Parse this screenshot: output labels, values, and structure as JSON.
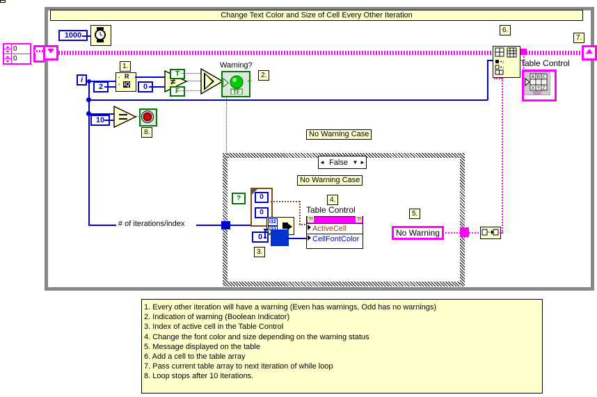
{
  "diagram": {
    "title": "Change Text Color and Size of Cell Every Other Iteration",
    "iteration_terminal": "i",
    "wait_constant": "1000",
    "wait_icon": "clock-icon",
    "divisor_constant": "2",
    "remainder_compare_constant": "0",
    "stop_compare_constant": "10",
    "quotient_remainder_labels": {
      "top": "R",
      "bottom": "IQ"
    },
    "not_equal_symbol": "≠",
    "equal_symbol": "=",
    "select_true_constant": "T",
    "select_false_constant": "F",
    "warning_indicator_label": "Warning?",
    "warning_indicator_tf": "TF",
    "iterations_wire_label": "# of iterations/index",
    "case_outer_label": "No Warning Case",
    "case_inner_label": "No Warning Case",
    "case_selector_value": "False",
    "case_selector_left_arrow": "◄",
    "case_selector_right_arrow": "►",
    "case_selector_chevron": "▼",
    "case_selector_terminal": "?",
    "property_node_label": "Table Control",
    "property_node_rows": [
      {
        "name": "ActiveCell",
        "color": "#8B4513"
      },
      {
        "name": "CellFontColor",
        "color": "#0000CC"
      }
    ],
    "cluster_constant_values": [
      "0",
      "0"
    ],
    "bundle_input_types": [
      "I32",
      "I32"
    ],
    "index_constant": "0",
    "no_warning_string": "No Warning",
    "table_indicator_label": "Table Control",
    "table_icon_rows": [
      [
        "A",
        "B",
        "C"
      ],
      [
        ":",
        ":",
        ":"
      ],
      [
        "X",
        "Y",
        "Z"
      ]
    ],
    "table_icon_type": "abc",
    "array_control_values": [
      "0",
      "0"
    ],
    "callouts": {
      "c1": "1.",
      "c2": "2.",
      "c3": "3.",
      "c4": "4.",
      "c5": "5.",
      "c6": "6.",
      "c7": "7.",
      "c8": "8."
    }
  },
  "legend": {
    "items": [
      "1. Every other iteration will have a warning (Even has warnings, Odd has no warnings)",
      "2. Indication of warning (Boolean Indicator)",
      "3. Index of active cell in the Table Control",
      "4. Change the font color and size depending on the warning status",
      "5. Message displayed on the table",
      "6. Add a cell to the table array",
      "7. Pass current table array to next iteration of while loop",
      "8. Loop stops after 10 iterations."
    ]
  },
  "colors": {
    "canvas": "#FFFFFF",
    "node_fill": "#FFFFCC",
    "wire_blue": "#0000CC",
    "wire_green": "#007700",
    "wire_pink": "#FF00FF",
    "wire_brown": "#8B4513",
    "loop_border": "#888888"
  }
}
